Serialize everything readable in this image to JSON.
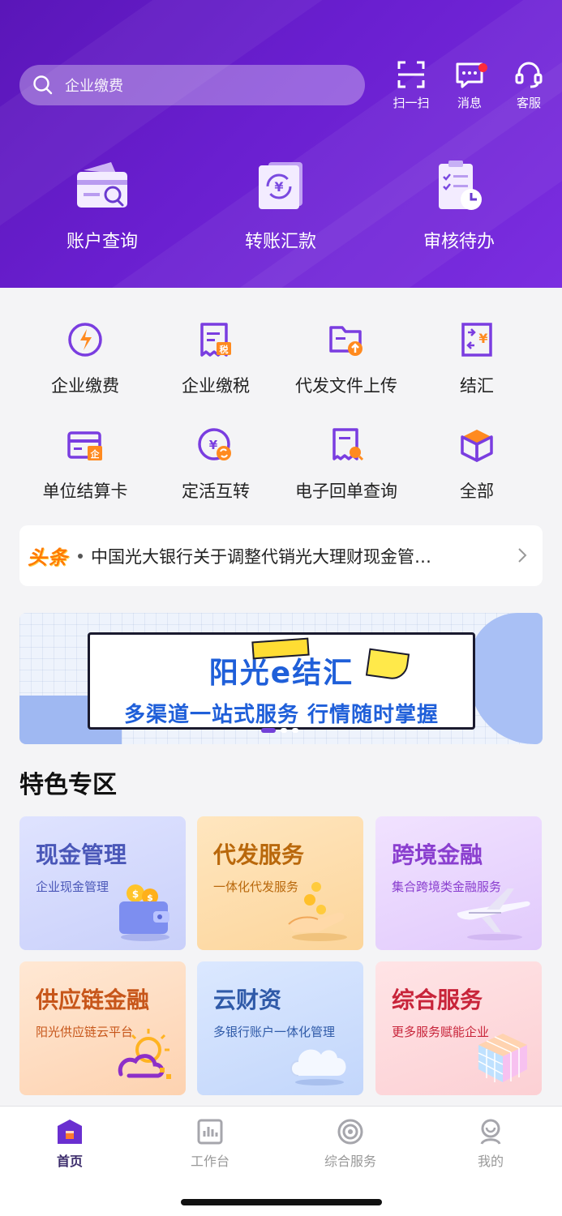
{
  "search": {
    "placeholder": "企业缴费"
  },
  "top_actions": [
    {
      "label": "扫一扫",
      "icon": "scan-icon"
    },
    {
      "label": "消息",
      "icon": "message-icon",
      "badge": true
    },
    {
      "label": "客服",
      "icon": "customer-service-icon"
    }
  ],
  "main_actions": [
    {
      "label": "账户查询",
      "icon": "account-query-icon"
    },
    {
      "label": "转账汇款",
      "icon": "transfer-icon"
    },
    {
      "label": "审核待办",
      "icon": "approval-todo-icon"
    }
  ],
  "services": [
    {
      "label": "企业缴费",
      "icon": "enterprise-payment-icon"
    },
    {
      "label": "企业缴税",
      "icon": "enterprise-tax-icon"
    },
    {
      "label": "代发文件上传",
      "icon": "file-upload-icon"
    },
    {
      "label": "结汇",
      "icon": "fx-settlement-icon"
    },
    {
      "label": "单位结算卡",
      "icon": "settlement-card-icon"
    },
    {
      "label": "定活互转",
      "icon": "deposit-transfer-icon"
    },
    {
      "label": "电子回单查询",
      "icon": "receipt-query-icon"
    },
    {
      "label": "全部",
      "icon": "all-services-icon"
    }
  ],
  "news": {
    "tag": "头条",
    "text": "中国光大银行关于调整代销光大理财现金管…"
  },
  "banner": {
    "title": "阳光e结汇",
    "subtitle": "多渠道一站式服务 行情随时掌握"
  },
  "features_title": "特色专区",
  "features": [
    {
      "title": "现金管理",
      "subtitle": "企业现金管理"
    },
    {
      "title": "代发服务",
      "subtitle": "一体化代发服务"
    },
    {
      "title": "跨境金融",
      "subtitle": "集合跨境类金融服务"
    },
    {
      "title": "供应链金融",
      "subtitle": "阳光供应链云平台"
    },
    {
      "title": "云财资",
      "subtitle": "多银行账户一体化管理"
    },
    {
      "title": "综合服务",
      "subtitle": "更多服务赋能企业"
    }
  ],
  "tabs": [
    {
      "label": "首页",
      "active": true
    },
    {
      "label": "工作台"
    },
    {
      "label": "综合服务"
    },
    {
      "label": "我的"
    }
  ],
  "colors": {
    "brand_purple": "#6a1fd0",
    "icon_purple": "#7a3de0",
    "accent_orange": "#ff7a00"
  }
}
